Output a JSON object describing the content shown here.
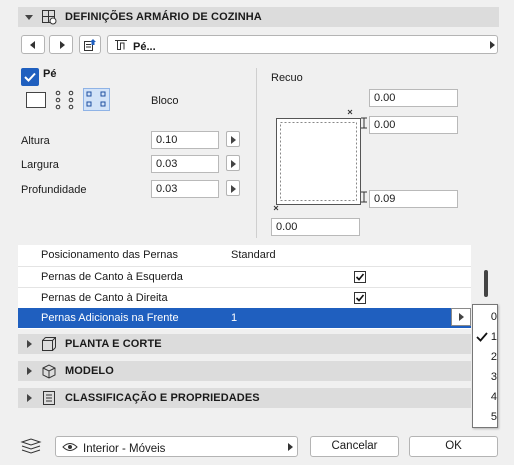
{
  "header": {
    "title": "DEFINIÇÕES ARMÁRIO DE COZINHA"
  },
  "toolbar": {
    "selector_label": "Pé..."
  },
  "pe": {
    "checkbox_label": "Pé",
    "checked": true,
    "style_label": "Bloco",
    "dimensions": [
      {
        "label": "Altura",
        "value": "0.10"
      },
      {
        "label": "Largura",
        "value": "0.03"
      },
      {
        "label": "Profundidade",
        "value": "0.03"
      }
    ]
  },
  "recuo": {
    "label": "Recuo",
    "top": "0.00",
    "right_top": "0.00",
    "right_bottom": "0.09",
    "bottom": "0.00"
  },
  "legs_table": {
    "rows": [
      {
        "label": "Posicionamento das Pernas",
        "value": "Standard",
        "type": "text"
      },
      {
        "label": "Pernas de Canto à Esquerda",
        "value": "",
        "type": "checkbox"
      },
      {
        "label": "Pernas de Canto à Direita",
        "value": "",
        "type": "checkbox"
      },
      {
        "label": "Pernas Adicionais na Frente",
        "value": "1",
        "type": "selected"
      }
    ]
  },
  "dropdown": {
    "options": [
      "0",
      "1",
      "2",
      "3",
      "4",
      "5"
    ],
    "selected": "1"
  },
  "sections": [
    {
      "title": "PLANTA E CORTE",
      "icon": "floorplan-icon"
    },
    {
      "title": "MODELO",
      "icon": "cube-icon"
    },
    {
      "title": "CLASSIFICAÇÃO E PROPRIEDADES",
      "icon": "document-icon"
    }
  ],
  "footer": {
    "view_label": "Interior - Móveis",
    "cancel_label": "Cancelar",
    "ok_label": "OK"
  },
  "colors": {
    "accent": "#1f5fbf",
    "selected_row": "#1f5fbf",
    "section_bg": "#dcdcdc"
  }
}
